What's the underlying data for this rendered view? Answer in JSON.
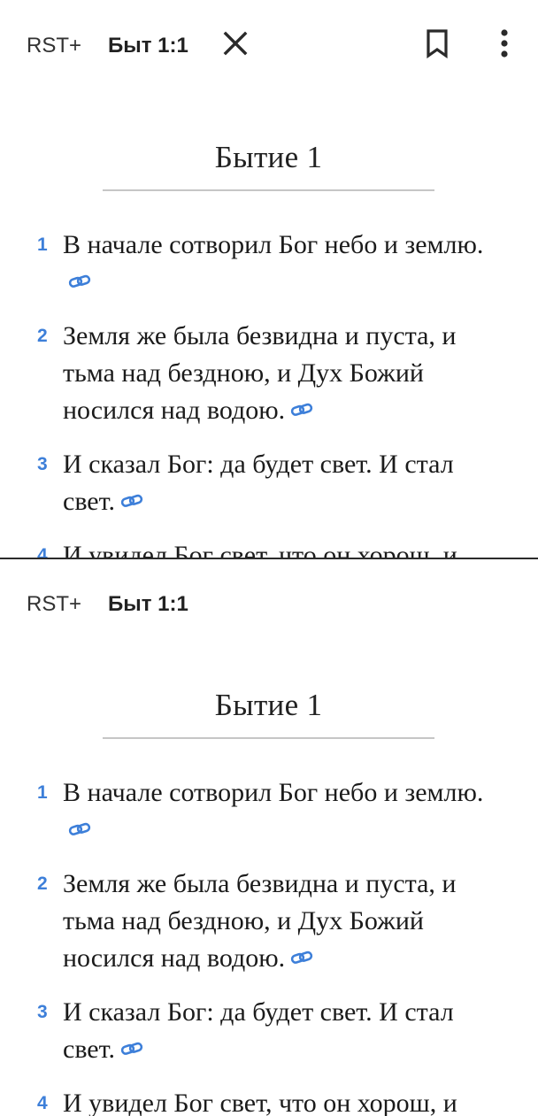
{
  "toolbar": {
    "translation": "RST+",
    "reference": "Быт 1:1"
  },
  "chapter": {
    "title": "Бытие 1"
  },
  "verses": [
    {
      "num": "1",
      "text": "В начале сотворил Бог небо и землю."
    },
    {
      "num": "2",
      "text": "Земля же была безвидна и пуста, и тьма над бездною, и Дух Божий носился над водою."
    },
    {
      "num": "3",
      "text": "И сказал Бог: да будет свет. И стал свет."
    },
    {
      "num": "4",
      "text": "И увидел Бог свет, что он хорош, и"
    }
  ],
  "colors": {
    "accent": "#3d7fd9",
    "text": "#1b1b1b",
    "divider": "#2b2b2b"
  },
  "icons": {
    "close": "close-icon",
    "bookmark": "bookmark-icon",
    "more": "more-vertical-icon",
    "link": "link-icon"
  }
}
